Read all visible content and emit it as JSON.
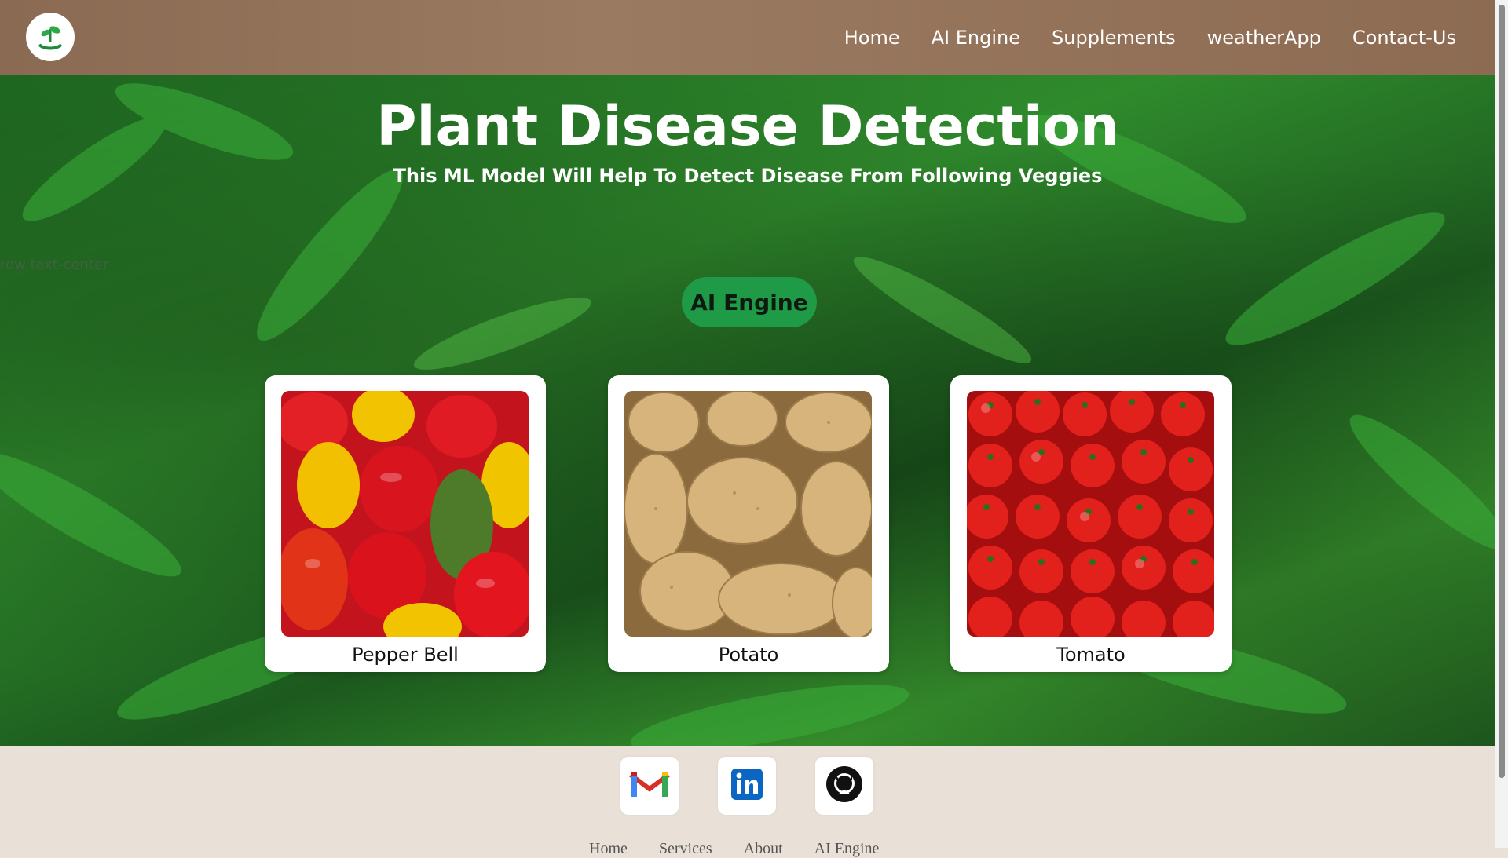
{
  "header": {
    "logo_name": "plant-hand-logo",
    "nav": [
      {
        "label": "Home"
      },
      {
        "label": "AI Engine"
      },
      {
        "label": "Supplements"
      },
      {
        "label": "weatherApp"
      },
      {
        "label": "Contact-Us"
      }
    ]
  },
  "hero": {
    "title": "Plant Disease Detection",
    "subtitle": "This ML Model Will Help To Detect Disease From Following Veggies",
    "ghost_text": "row text-center",
    "cta_label": "AI Engine",
    "colors": {
      "cta_bg": "#1f9a47",
      "accent": "#2f8a2c"
    }
  },
  "cards": [
    {
      "label": "Pepper Bell",
      "image": "bell-peppers"
    },
    {
      "label": "Potato",
      "image": "potatoes"
    },
    {
      "label": "Tomato",
      "image": "tomatoes"
    }
  ],
  "footer": {
    "social": [
      {
        "name": "gmail-icon"
      },
      {
        "name": "linkedin-icon"
      },
      {
        "name": "github-icon"
      }
    ],
    "links": [
      {
        "label": "Home"
      },
      {
        "label": "Services"
      },
      {
        "label": "About"
      },
      {
        "label": "AI Engine"
      }
    ]
  }
}
